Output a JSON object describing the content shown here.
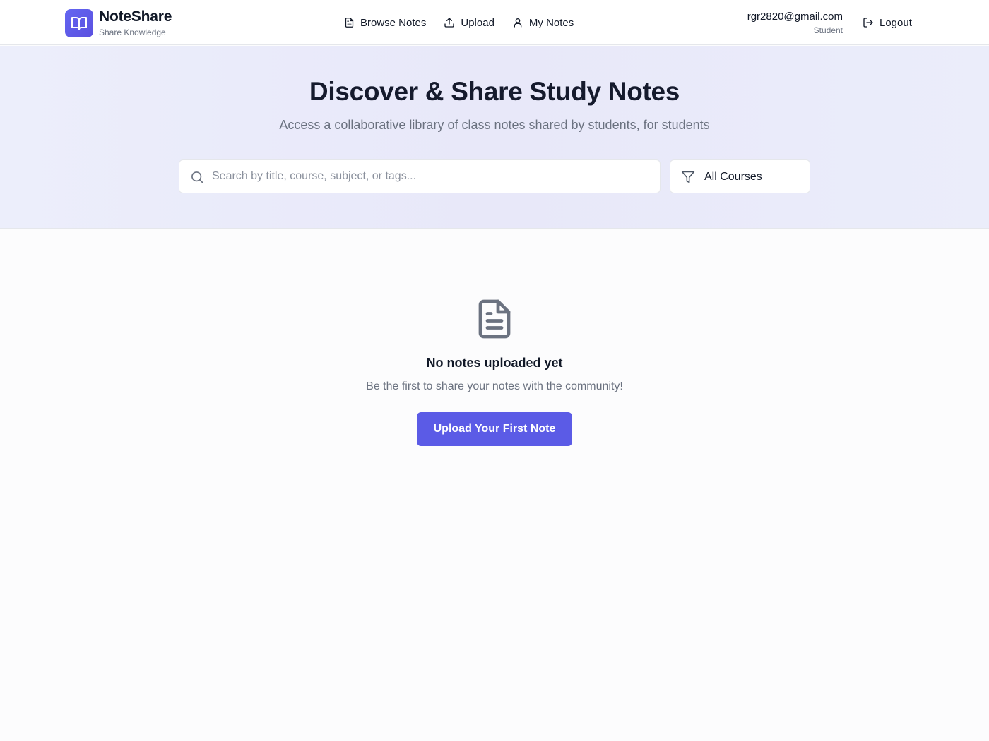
{
  "brand": {
    "name": "NoteShare",
    "tagline": "Share Knowledge",
    "logo_icon": "open-book-icon",
    "accent": "#5b5be6"
  },
  "nav": {
    "items": [
      {
        "label": "Browse Notes",
        "icon": "file-text-icon"
      },
      {
        "label": "Upload",
        "icon": "upload-icon"
      },
      {
        "label": "My Notes",
        "icon": "user-icon"
      }
    ]
  },
  "user": {
    "email": "rgr2820@gmail.com",
    "role": "Student",
    "logout_label": "Logout",
    "logout_icon": "logout-icon"
  },
  "hero": {
    "title": "Discover & Share Study Notes",
    "subtitle": "Access a collaborative library of class notes shared by students, for students",
    "search": {
      "placeholder": "Search by title, course, subject, or tags...",
      "value": "",
      "icon": "search-icon"
    },
    "filter": {
      "selected": "All Courses",
      "icon": "filter-icon"
    }
  },
  "empty_state": {
    "icon": "document-icon",
    "title": "No notes uploaded yet",
    "message": "Be the first to share your notes with the community!",
    "cta_label": "Upload Your First Note"
  }
}
